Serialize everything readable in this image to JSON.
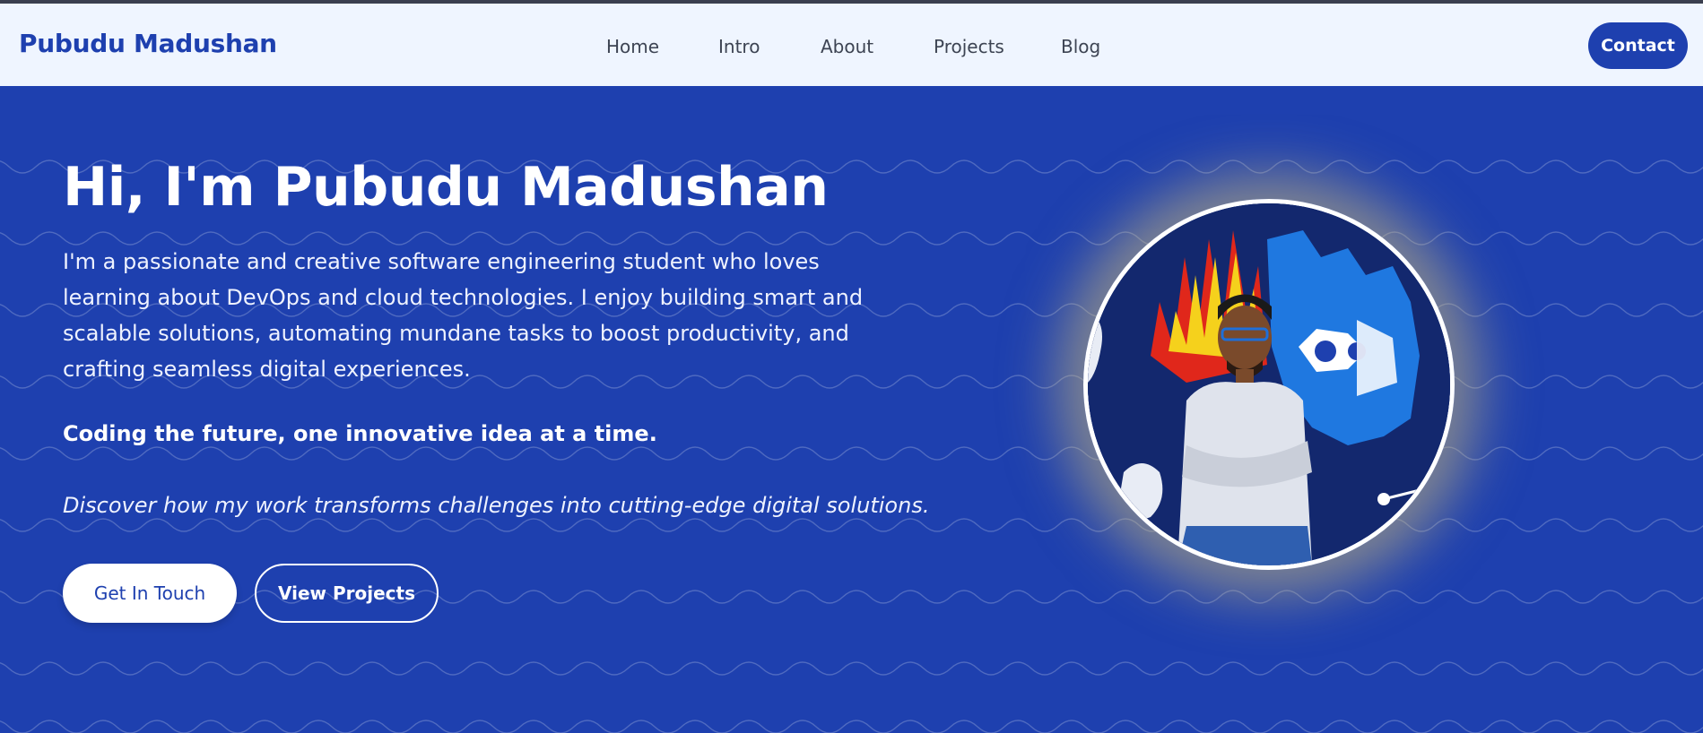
{
  "navbar": {
    "brand": "Pubudu Madushan",
    "links": [
      "Home",
      "Intro",
      "About",
      "Projects",
      "Blog"
    ],
    "contact_label": "Contact"
  },
  "hero": {
    "title": "Hi, I'm Pubudu Madushan",
    "description": "I'm a passionate and creative software engineering student who loves learning about DevOps and cloud technologies. I enjoy building smart and scalable solutions, automating mundane tasks to boost productivity, and crafting seamless digital experiences.",
    "tagline": "Coding the future, one innovative idea at a time.",
    "subtext": "Discover how my work transforms challenges into cutting-edge digital solutions.",
    "primary_button": "Get In Touch",
    "secondary_button": "View Projects"
  },
  "colors": {
    "brand": "#1e40af",
    "navbar_bg": "#eff5ff",
    "hero_bg": "#1e40af",
    "button_text_light": "#ffffff"
  },
  "icons": {
    "avatar": "profile-photo"
  }
}
